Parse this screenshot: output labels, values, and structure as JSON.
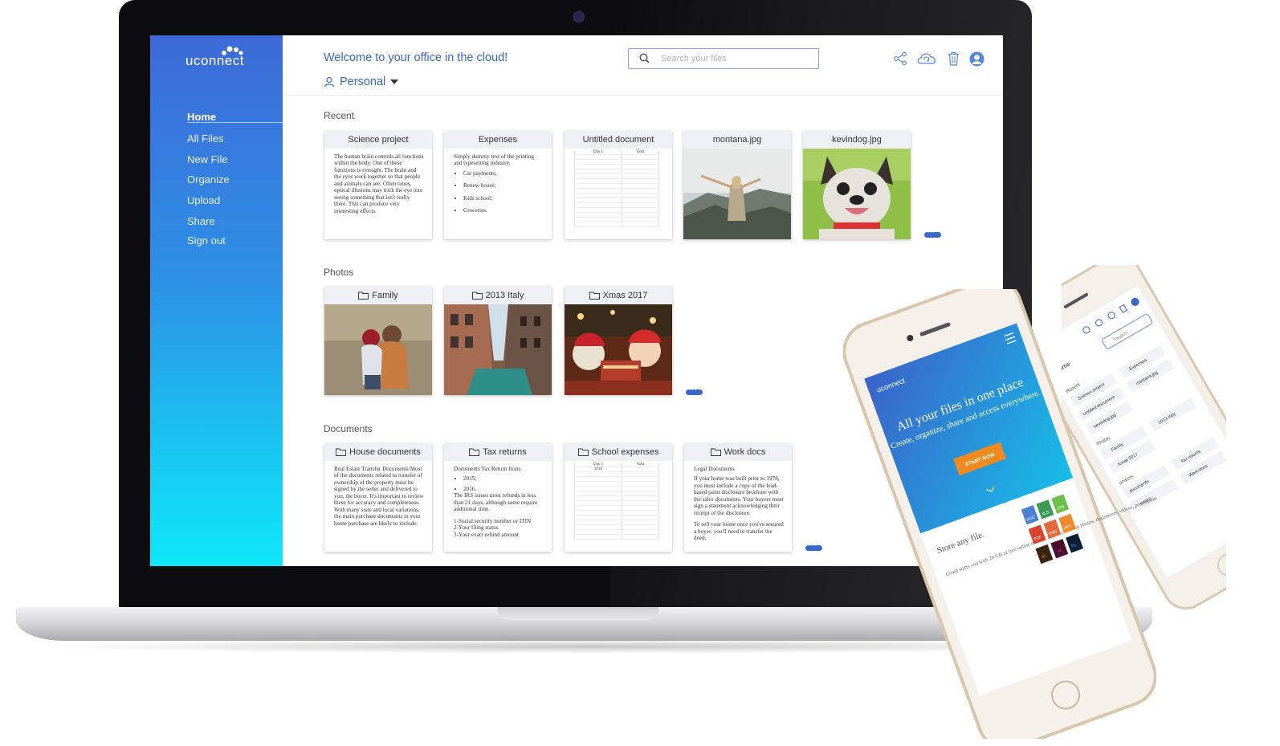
{
  "app": {
    "logo": "uconnect",
    "welcome": "Welcome to your office in the cloud!",
    "account_label": "Personal"
  },
  "search": {
    "placeholder": "Search your files"
  },
  "sidebar": {
    "items": [
      {
        "label": "Home",
        "active": true
      },
      {
        "label": "All Files"
      },
      {
        "label": "New File"
      },
      {
        "label": "Organize"
      },
      {
        "label": "Upload"
      },
      {
        "label": "Share"
      },
      {
        "label": "Sign out"
      }
    ]
  },
  "header_icons": [
    "share-icon",
    "cloud-sync-icon",
    "trash-icon",
    "user-avatar-icon"
  ],
  "sections": {
    "recent": {
      "title": "Recent",
      "cards": [
        {
          "title": "Science project",
          "type": "text",
          "body": "The human brain controls all functions within the body. One of these functions is eyesight. The brain and the eyes work together so that people and animals can see. Often times, optical illusions may trick the eye into seeing something that isn't really there. This can produce very interesting effects."
        },
        {
          "title": "Expenses",
          "type": "list",
          "body": "Simply dummy text of the printing and typesetting industry.",
          "items": [
            "Car payments;",
            "Renew house;",
            "Kids school;",
            "Groceries."
          ]
        },
        {
          "title": "Untitled document",
          "type": "sheet",
          "col1": "Day 1",
          "col2": "Cost"
        },
        {
          "title": "montana.jpg",
          "type": "photo"
        },
        {
          "title": "kevindog.jpg",
          "type": "photo"
        }
      ]
    },
    "photos": {
      "title": "Photos",
      "folders": [
        {
          "title": "Family"
        },
        {
          "title": "2013 Italy"
        },
        {
          "title": "Xmas 2017"
        }
      ]
    },
    "documents": {
      "title": "Documents",
      "folders": [
        {
          "title": "House documents",
          "body": "Real Estate Transfer Documents Most of the documents related to transfer of ownership of the property must be signed by the seller and delivered to you, the buyer. It's important to review these for accuracy and completeness. With many state and local variations, the main purchase documents in your home purchase are likely to include:"
        },
        {
          "title": "Tax returns",
          "body_head": "Documents Tax Return from:",
          "items": [
            "2015;",
            "2016."
          ],
          "body": "The IRS issues most refunds in less than 21 days, although some require additional time.",
          "lines": [
            "1-Social security number or ITIN",
            "2-Your filing status",
            "3-Your exact refund amount"
          ]
        },
        {
          "title": "School expenses",
          "col1": "Day 1",
          "col2": "Cost",
          "cell": "2018"
        },
        {
          "title": "Work docs",
          "head": "Legal Documents",
          "body": "If your home was built prior to 1978, you must include a copy of the lead-based paint disclosure brochure with the sales documents. Your buyers must sign a statement acknowledging their receipt of the disclosure.",
          "body2": "To sell your home once you've secured a buyer, you'll need to transfer the deed."
        }
      ]
    }
  },
  "phone_front": {
    "logo": "uconnect",
    "headline": "All your files in one place",
    "subline": "Create, organize, share and access everywhere.",
    "cta": "START NOW",
    "store_title": "Store any file.",
    "store_body": "Cloud starts you with 20 GB of free online storage, so you can keep photos, documents, videos, presentations, spreadsheets – anything.",
    "file_badges": [
      "DOC",
      "XLS",
      "JPG",
      "PDF",
      "PNG",
      "PPT",
      "Ai",
      "Id",
      "Ps"
    ]
  },
  "phone_back": {
    "home": "Home",
    "search_placeholder": "Search",
    "recent_label": "Recent",
    "recent_items": [
      "Science project",
      "Expenses",
      "Untitled document",
      "montana.jpg",
      "kevindog.jpg"
    ],
    "photos_label": "Photos",
    "photo_items": [
      "Family",
      "2013 Italy",
      "Xmas 2017"
    ],
    "documents_label": "uments",
    "document_items": [
      "documents",
      "Tax returns",
      "enses",
      "Work docs"
    ]
  },
  "colors": {
    "accent": "#3a68c8",
    "sidebar_top": "#3d6ad6",
    "sidebar_bottom": "#0ee8f8",
    "cta": "#f08a1e"
  }
}
